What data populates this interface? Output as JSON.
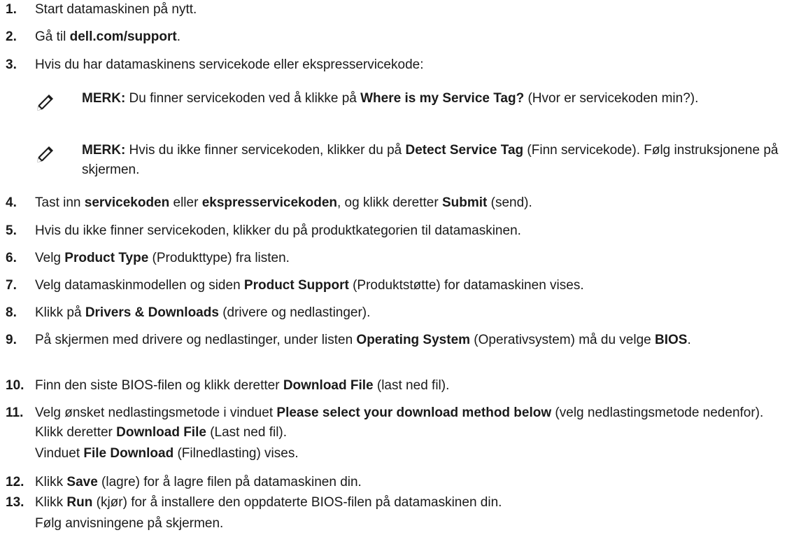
{
  "steps": [
    {
      "num": "1.",
      "parts": [
        {
          "t": "Start datamaskinen på nytt."
        }
      ]
    },
    {
      "num": "2.",
      "parts": [
        {
          "t": "Gå til "
        },
        {
          "t": "dell.com/support",
          "b": true
        },
        {
          "t": "."
        }
      ]
    },
    {
      "num": "3.",
      "parts": [
        {
          "t": "Hvis du har datamaskinens servicekode eller ekspresservicekode:"
        }
      ]
    },
    {
      "num": "4.",
      "parts": [
        {
          "t": "Tast inn "
        },
        {
          "t": "servicekoden",
          "b": true
        },
        {
          "t": " eller "
        },
        {
          "t": "ekspresservicekoden",
          "b": true
        },
        {
          "t": ", og klikk deretter "
        },
        {
          "t": "Submit",
          "b": true
        },
        {
          "t": " (send)."
        }
      ]
    },
    {
      "num": "5.",
      "parts": [
        {
          "t": "Hvis du ikke finner servicekoden, klikker du på produktkategorien til datamaskinen."
        }
      ]
    },
    {
      "num": "6.",
      "parts": [
        {
          "t": "Velg "
        },
        {
          "t": "Product Type",
          "b": true
        },
        {
          "t": " (Produkttype) fra listen."
        }
      ]
    },
    {
      "num": "7.",
      "parts": [
        {
          "t": "Velg datamaskinmodellen og siden "
        },
        {
          "t": "Product Support",
          "b": true
        },
        {
          "t": " (Produktstøtte) for datamaskinen vises."
        }
      ]
    },
    {
      "num": "8.",
      "parts": [
        {
          "t": "Klikk på "
        },
        {
          "t": "Drivers & Downloads",
          "b": true
        },
        {
          "t": " (drivere og nedlastinger)."
        }
      ]
    },
    {
      "num": "9.",
      "parts": [
        {
          "t": "På skjermen med drivere og nedlastinger, under listen "
        },
        {
          "t": "Operating System",
          "b": true
        },
        {
          "t": " (Operativsystem) må du velge "
        },
        {
          "t": "BIOS",
          "b": true
        },
        {
          "t": "."
        }
      ]
    },
    {
      "num": "10.",
      "parts": [
        {
          "t": "Finn den siste BIOS-filen og klikk deretter "
        },
        {
          "t": "Download File",
          "b": true
        },
        {
          "t": " (last ned fil)."
        }
      ]
    },
    {
      "num": "11.",
      "parts": [
        {
          "t": "Velg ønsket nedlastingsmetode i vinduet "
        },
        {
          "t": "Please select your download method below",
          "b": true
        },
        {
          "t": " (velg nedlastingsmetode nedenfor). Klikk deretter "
        },
        {
          "t": "Download File",
          "b": true
        },
        {
          "t": " (Last ned fil)."
        }
      ]
    },
    {
      "num": "12.",
      "parts": [
        {
          "t": "Klikk "
        },
        {
          "t": "Save",
          "b": true
        },
        {
          "t": " (lagre) for å lagre filen på datamaskinen din."
        }
      ]
    },
    {
      "num": "13.",
      "parts": [
        {
          "t": "Klikk "
        },
        {
          "t": "Run",
          "b": true
        },
        {
          "t": " (kjør) for å installere den oppdaterte BIOS-filen på datamaskinen din."
        }
      ]
    }
  ],
  "notes": [
    {
      "label": "MERK:",
      "icon": "note-pencil-icon",
      "parts": [
        {
          "t": " Du finner servicekoden ved å klikke på "
        },
        {
          "t": "Where is my Service Tag?",
          "b": true
        },
        {
          "t": " (Hvor er servicekoden min?)."
        }
      ]
    },
    {
      "label": "MERK:",
      "icon": "note-pencil-icon",
      "parts": [
        {
          "t": " Hvis du ikke finner servicekoden, klikker du på "
        },
        {
          "t": "Detect Service Tag",
          "b": true
        },
        {
          "t": " (Finn servicekode). Følg instruksjonene på skjermen."
        }
      ]
    }
  ],
  "step11_sub": [
    {
      "t": "Vinduet "
    },
    {
      "t": "File Download",
      "b": true
    },
    {
      "t": " (Filnedlasting) vises."
    }
  ],
  "step13_sub": [
    {
      "t": "Følg anvisningene på skjermen."
    }
  ]
}
